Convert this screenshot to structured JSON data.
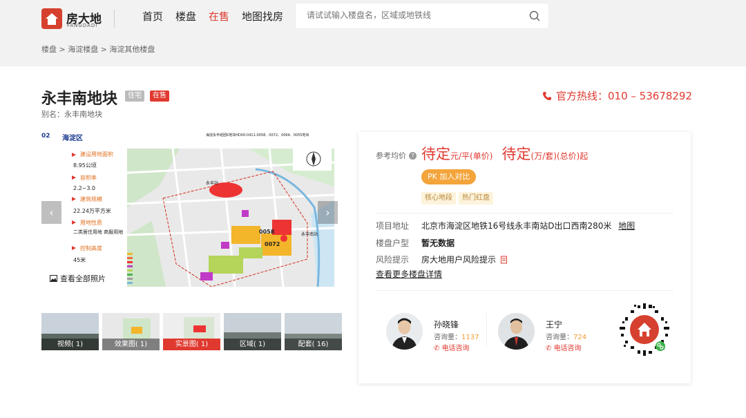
{
  "brand": {
    "name_cn": "房大地",
    "name_en": "FANGDADI"
  },
  "nav": [
    {
      "label": "首页",
      "active": false
    },
    {
      "label": "楼盘",
      "active": false
    },
    {
      "label": "在售",
      "active": true
    },
    {
      "label": "地图找房",
      "active": false
    }
  ],
  "search": {
    "placeholder": "请试试输入楼盘名，区域或地铁线"
  },
  "breadcrumb": "楼盘 > 海淀楼盘 > 海淀其他楼盘",
  "property": {
    "title": "永丰南地块",
    "tag_type": "住宅",
    "tag_status": "在售",
    "alias": "别名：永丰南地块"
  },
  "hotline": {
    "text": "官方热线：010 – 53678292"
  },
  "gallery": {
    "map_heading": "海淀永丰组团K地块HD00-0411-0058、0072、0064、0055地块",
    "district": "海淀区",
    "corner_num": "02",
    "specs": [
      {
        "label": "建设用地面积",
        "value": "8.95公顷"
      },
      {
        "label": "容积率",
        "value": "2.2~3.0"
      },
      {
        "label": "建筑规模",
        "value": "22.24万平方米"
      },
      {
        "label": "用地性质",
        "value": "二类居住用地 商服用地"
      },
      {
        "label": "控制高度",
        "value": "45米"
      }
    ],
    "parcel_labels": [
      "0058",
      "0072"
    ],
    "station_labels": [
      "永丰站",
      "永丰南站"
    ],
    "view_all": "查看全部照片",
    "prev_arrow": "‹",
    "next_arrow": "›"
  },
  "thumbnails": [
    {
      "label": "视频( 1)",
      "active": false
    },
    {
      "label": "效果图( 1)",
      "active": false
    },
    {
      "label": "实景图( 1)",
      "active": true
    },
    {
      "label": "区域( 1)",
      "active": false
    },
    {
      "label": "配套( 16)",
      "active": false
    }
  ],
  "card": {
    "price_label": "参考均价",
    "price_unit_value": "待定",
    "price_unit_suffix": "元/平(单价)",
    "price_total_value": "待定",
    "price_total_suffix": "(万/套)(总价)起",
    "pk_label": "PK  加入对比",
    "features": [
      "核心地段",
      "热门红盘"
    ],
    "address_label": "项目地址",
    "address_value": "北京市海淀区地铁16号线永丰南站D出口西南280米",
    "map_link": "地图",
    "layout_label": "楼盘户型",
    "layout_value": "暂无数据",
    "risk_label": "风险提示",
    "risk_value": "房大地用户风险提示",
    "more_link": "查看更多楼盘详情"
  },
  "agents": [
    {
      "name": "孙晓锋",
      "count_label": "咨询量：",
      "count": "1137",
      "call": "电话咨询"
    },
    {
      "name": "王宁",
      "count_label": "咨询量：",
      "count": "724",
      "call": "电话咨询"
    }
  ]
}
